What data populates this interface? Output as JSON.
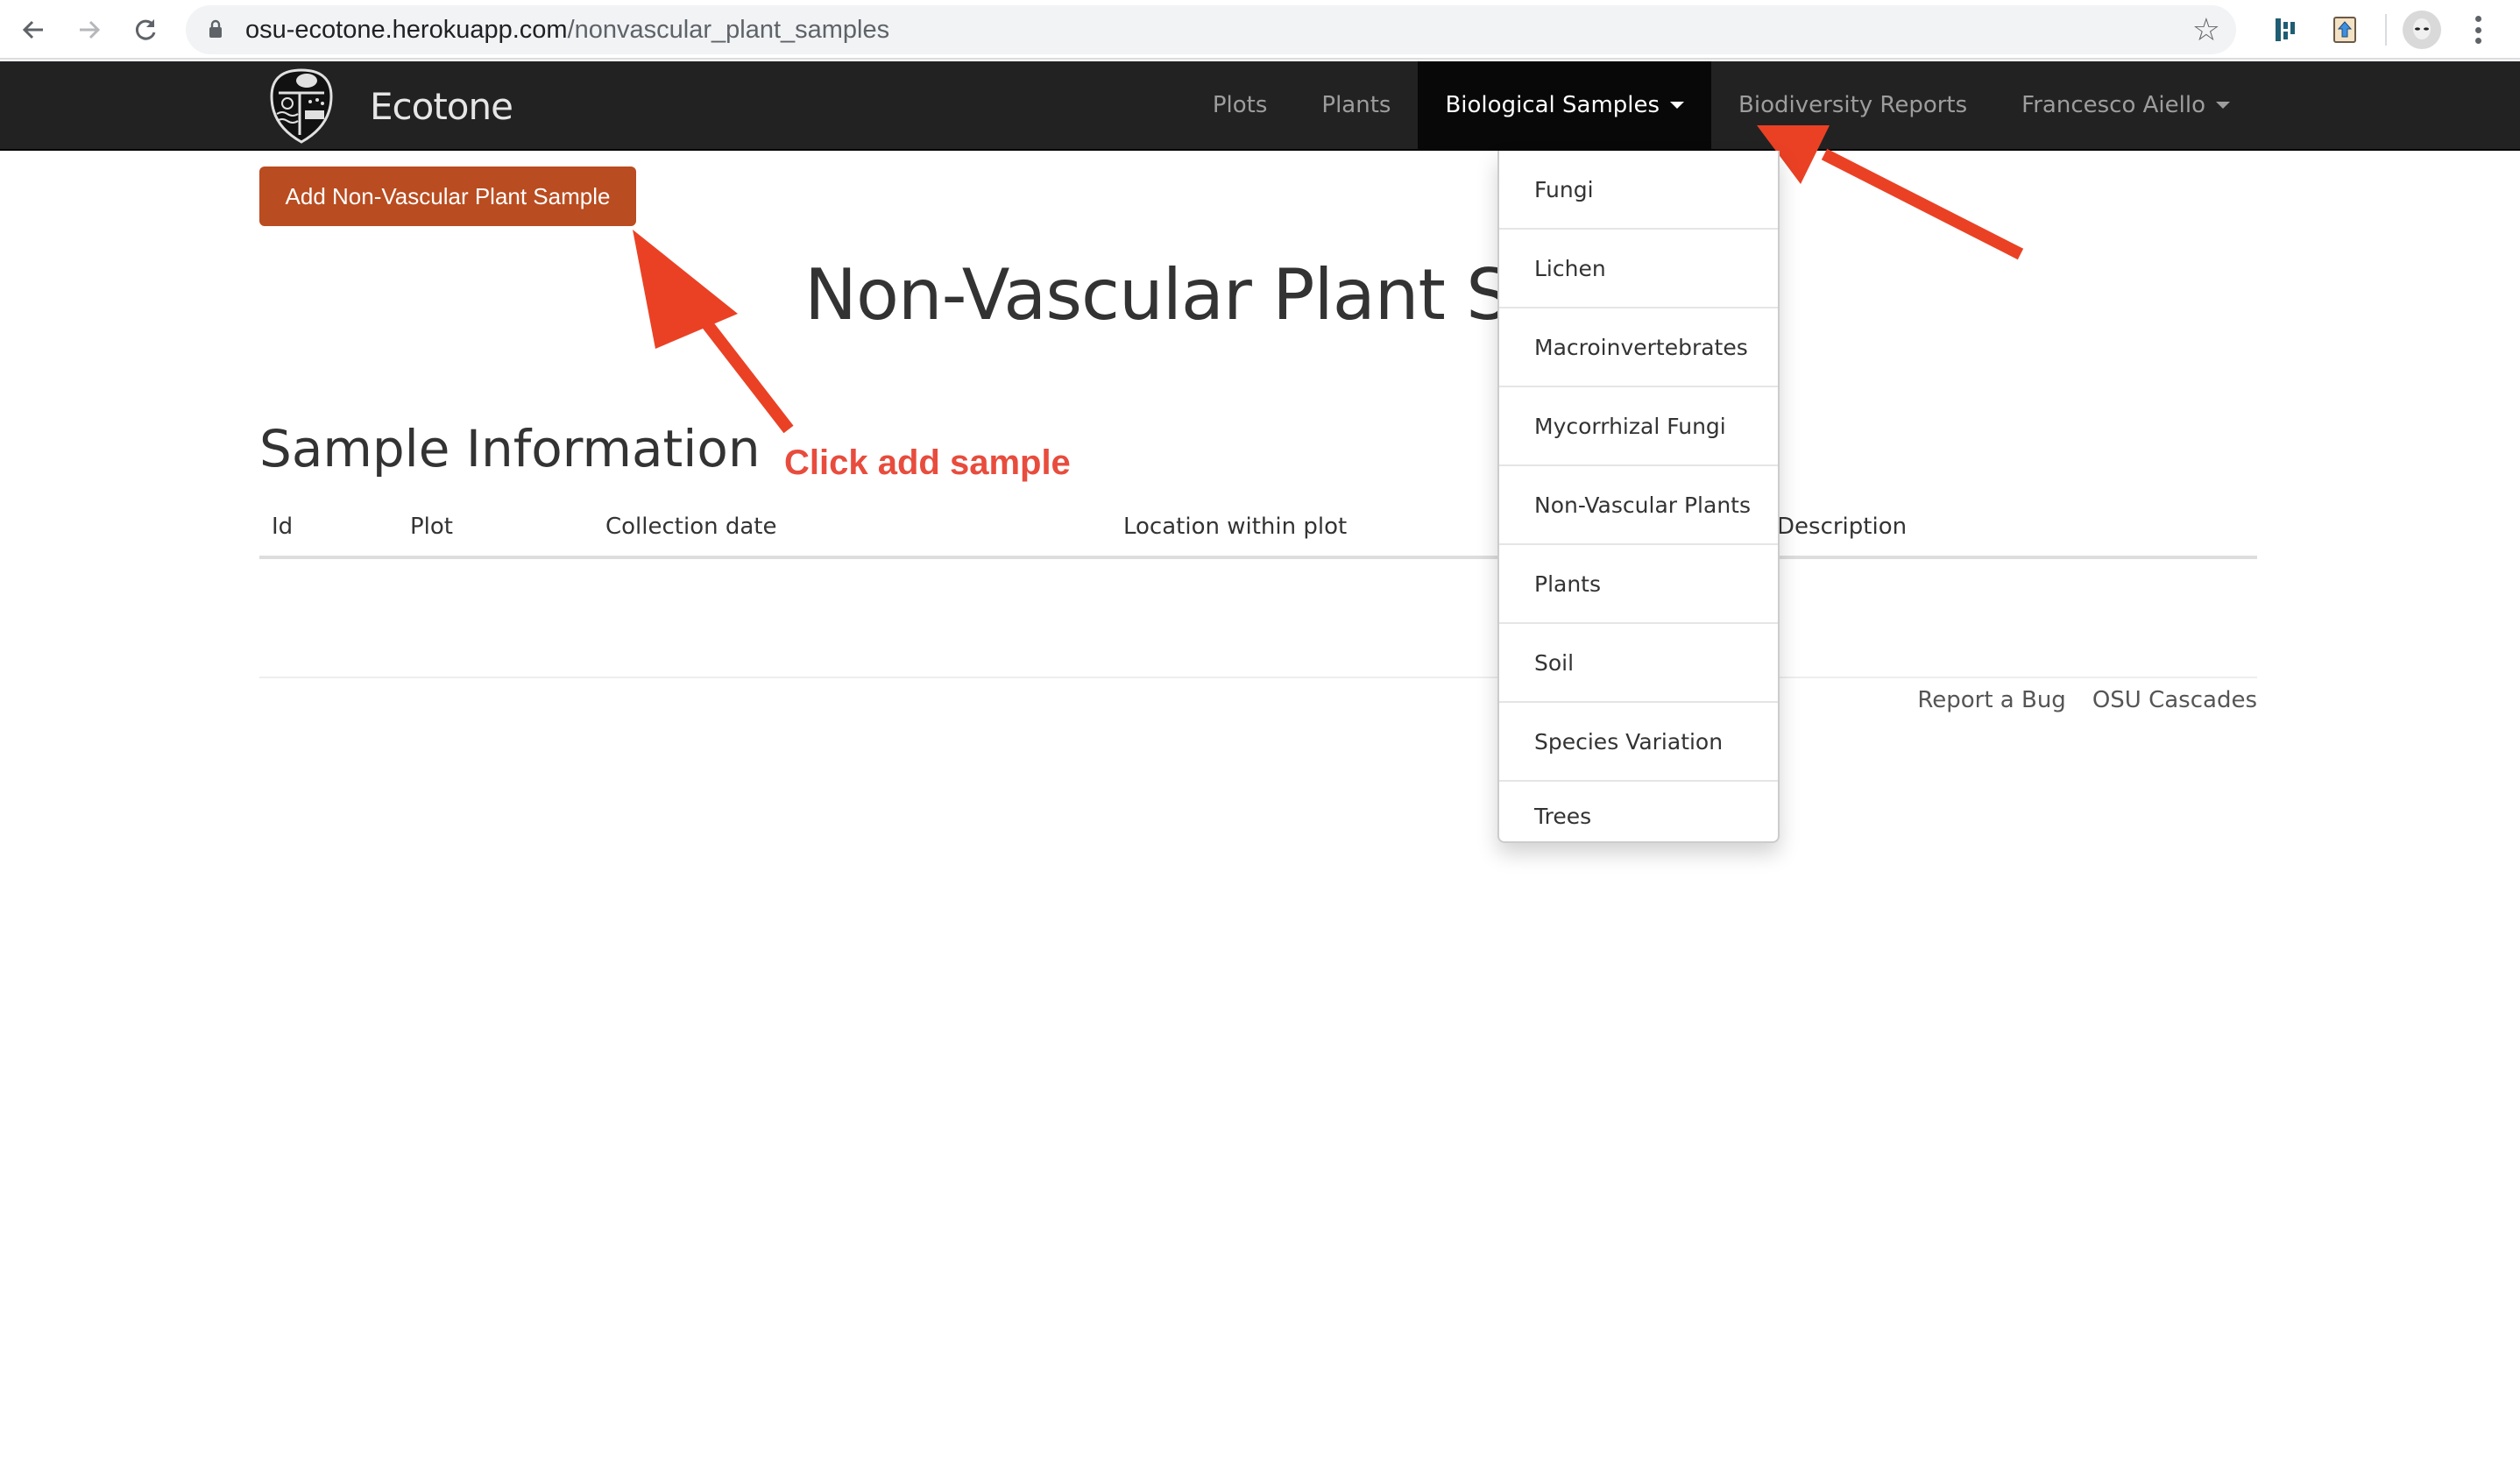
{
  "browser": {
    "url_host": "osu-ecotone.herokuapp.com",
    "url_path": "/nonvascular_plant_samples",
    "icons": {
      "back": "arrow-left-icon",
      "forward": "arrow-right-icon",
      "reload": "reload-icon",
      "lock": "lock-icon",
      "bookmark": "star-icon",
      "extension_1": "dashlane-icon",
      "extension_2": "upload-book-icon",
      "profile": "alien-avatar-icon",
      "menu": "kebab-menu-icon"
    }
  },
  "navbar": {
    "brand": "Ecotone",
    "items": [
      {
        "label": "Plots",
        "active": false
      },
      {
        "label": "Plants",
        "active": false
      },
      {
        "label": "Biological Samples",
        "active": true,
        "dropdown": true
      },
      {
        "label": "Biodiversity Reports",
        "active": false
      },
      {
        "label": "Francesco Aiello",
        "active": false,
        "dropdown": true
      }
    ]
  },
  "dropdown": {
    "items": [
      "Fungi",
      "Lichen",
      "Macroinvertebrates",
      "Mycorrhizal Fungi",
      "Non-Vascular Plants",
      "Plants",
      "Soil",
      "Species Variation",
      "Trees"
    ]
  },
  "main": {
    "add_button": "Add Non-Vascular Plant Sample",
    "page_title": "Non-Vascular Plant Samples",
    "section_title": "Sample Information",
    "table": {
      "columns": [
        "Id",
        "Plot",
        "Collection date",
        "Location within plot",
        "Description"
      ],
      "rows": []
    }
  },
  "footer": {
    "links": [
      "Report a Bug",
      "OSU Cascades"
    ]
  },
  "annotations": {
    "callout": "Click add sample",
    "color": "#e84c3d"
  },
  "colors": {
    "navbar_bg": "#222222",
    "navbar_active_bg": "#080808",
    "primary_button": "#b94c20"
  }
}
